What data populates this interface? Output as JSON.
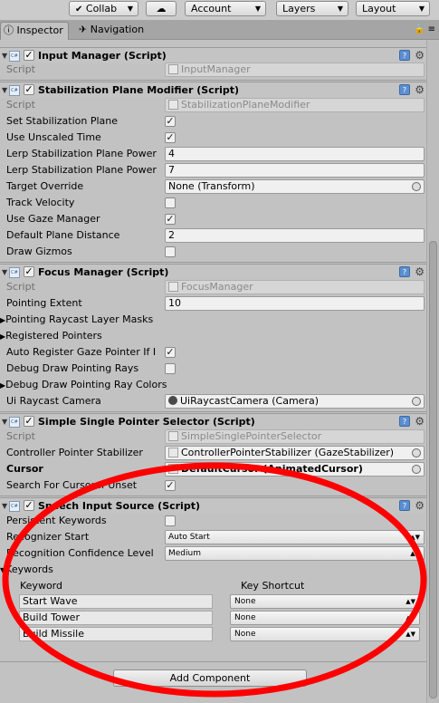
{
  "toolbar": {
    "collab": "Collab",
    "account": "Account",
    "layers": "Layers",
    "layout": "Layout"
  },
  "tabs": {
    "inspector": "Inspector",
    "navigation": "Navigation"
  },
  "components": {
    "input_manager": {
      "title": "Input Manager (Script)",
      "script_label": "Script",
      "script_value": "InputManager"
    },
    "stabilization": {
      "title": "Stabilization Plane Modifier (Script)",
      "script_label": "Script",
      "script_value": "StabilizationPlaneModifier",
      "fields": [
        {
          "label": "Set Stabilization Plane",
          "type": "check",
          "checked": true
        },
        {
          "label": "Use Unscaled Time",
          "type": "check",
          "checked": true
        },
        {
          "label": "Lerp Stabilization Plane Power",
          "type": "text",
          "value": "4"
        },
        {
          "label": "Lerp Stabilization Plane Power",
          "type": "text",
          "value": "7"
        },
        {
          "label": "Target Override",
          "type": "text",
          "value": "None (Transform)"
        },
        {
          "label": "Track Velocity",
          "type": "check",
          "checked": false
        },
        {
          "label": "Use Gaze Manager",
          "type": "check",
          "checked": true
        },
        {
          "label": "Default Plane Distance",
          "type": "text",
          "value": "2"
        },
        {
          "label": "Draw Gizmos",
          "type": "check",
          "checked": false
        }
      ]
    },
    "focus": {
      "title": "Focus Manager (Script)",
      "script_label": "Script",
      "script_value": "FocusManager",
      "pointing_extent_label": "Pointing Extent",
      "pointing_extent_value": "10",
      "raycast_masks_label": "Pointing Raycast Layer Masks",
      "registered_pointers_label": "Registered Pointers",
      "auto_register_label": "Auto Register Gaze Pointer If I",
      "debug_rays_label": "Debug Draw Pointing Rays",
      "debug_colors_label": "Debug Draw Pointing Ray Colors",
      "ui_camera_label": "Ui Raycast Camera",
      "ui_camera_value": "UiRaycastCamera (Camera)"
    },
    "selector": {
      "title": "Simple Single Pointer Selector (Script)",
      "script_label": "Script",
      "script_value": "SimpleSinglePointerSelector",
      "stabilizer_label": "Controller Pointer Stabilizer",
      "stabilizer_value": "ControllerPointerStabilizer (GazeStabilizer)",
      "cursor_label": "Cursor",
      "cursor_value": "DefaultCursor (AnimatedCursor)",
      "search_label": "Search For Cursor If Unset"
    },
    "speech": {
      "title": "Speech Input Source (Script)",
      "persistent_label": "Persistent Keywords",
      "recognizer_label": "Recognizer Start",
      "recognizer_value": "Auto Start",
      "confidence_label": "Recognition Confidence Level",
      "confidence_value": "Medium",
      "keywords_label": "Keywords",
      "col_keyword": "Keyword",
      "col_shortcut": "Key Shortcut",
      "rows": [
        {
          "keyword": "Start Wave",
          "shortcut": "None"
        },
        {
          "keyword": "Build Tower",
          "shortcut": "None"
        },
        {
          "keyword": "Build Missile",
          "shortcut": "None"
        }
      ]
    }
  },
  "add_component": "Add Component",
  "annotation": {
    "color": "#ff0000"
  }
}
